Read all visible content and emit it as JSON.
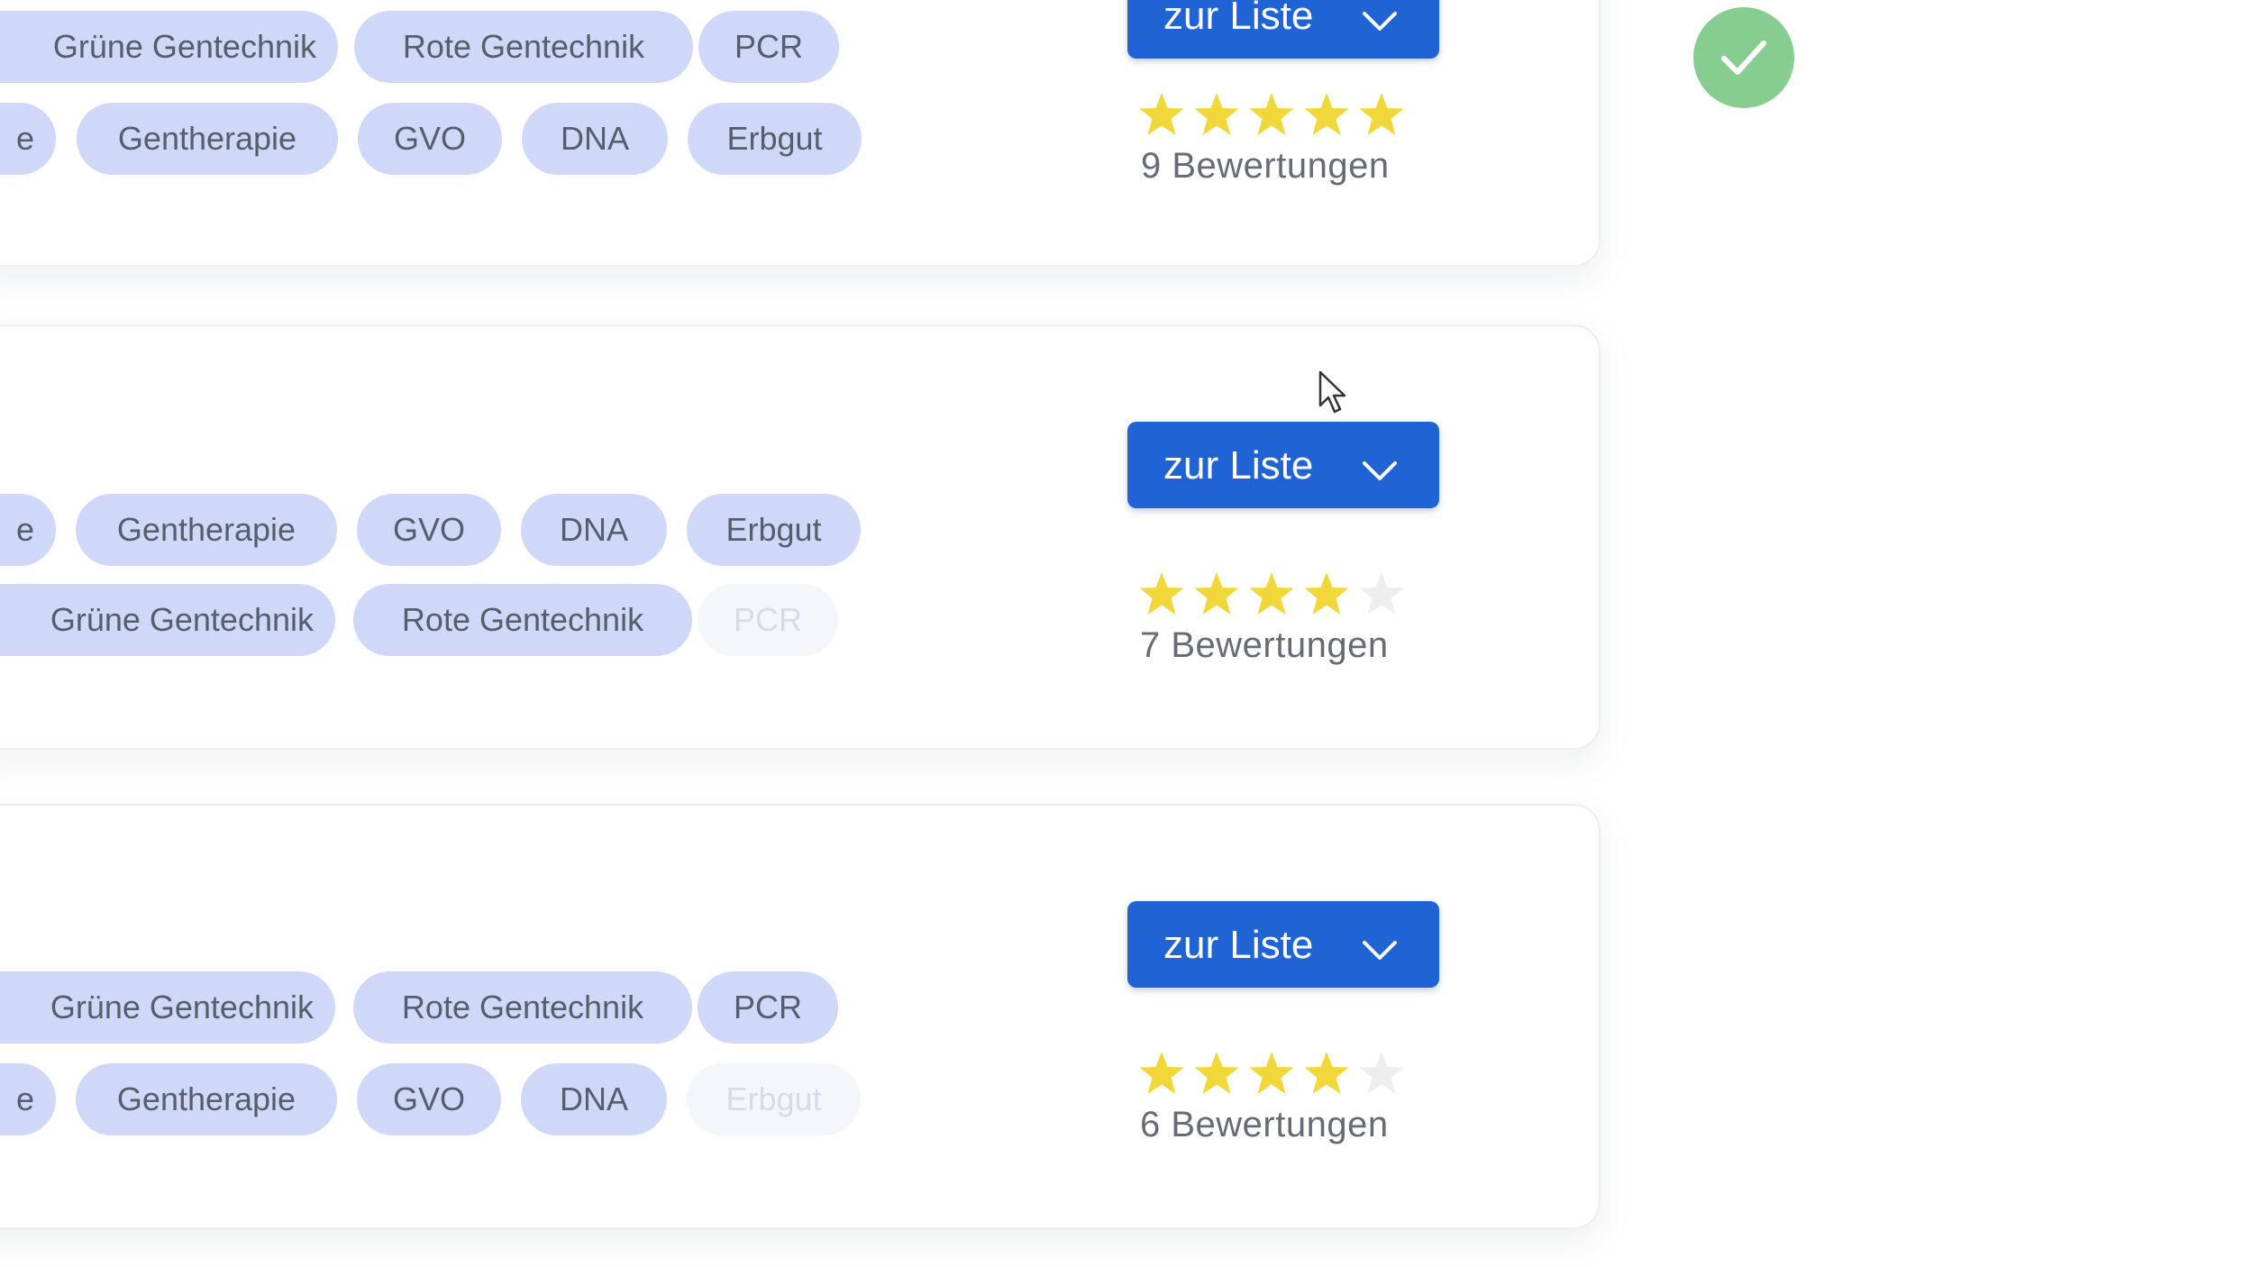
{
  "colors": {
    "tag_bg": "#cfd8f9",
    "tag_faded_bg": "#f5f6fb",
    "button_bg": "#1f63d4",
    "star_filled": "#f2d73b",
    "star_empty": "#eeeeee",
    "check_bg": "#87cd8f"
  },
  "icons": {
    "button_chevron": "chevron-down-icon",
    "star": "star-icon",
    "status": "check-icon",
    "pointer": "cursor-icon"
  },
  "cards": [
    {
      "button_label": "zur Liste",
      "rating": 5,
      "max_rating": 5,
      "ratings_count": "9 Bewertungen",
      "tag_rows": [
        [
          "Grüne Gentechnik",
          "Rote Gentechnik",
          "PCR"
        ],
        [
          "e",
          "Gentherapie",
          "GVO",
          "DNA",
          "Erbgut"
        ]
      ]
    },
    {
      "button_label": "zur Liste",
      "rating": 4,
      "max_rating": 5,
      "ratings_count": "7 Bewertungen",
      "tag_rows": [
        [
          "e",
          "Gentherapie",
          "GVO",
          "DNA",
          "Erbgut"
        ],
        [
          "Grüne Gentechnik",
          "Rote Gentechnik",
          "PCR"
        ]
      ]
    },
    {
      "button_label": "zur Liste",
      "rating": 4,
      "max_rating": 5,
      "ratings_count": "6 Bewertungen",
      "tag_rows": [
        [
          "Grüne Gentechnik",
          "Rote Gentechnik",
          "PCR"
        ],
        [
          "e",
          "Gentherapie",
          "GVO",
          "DNA",
          "Erbgut"
        ]
      ]
    }
  ]
}
